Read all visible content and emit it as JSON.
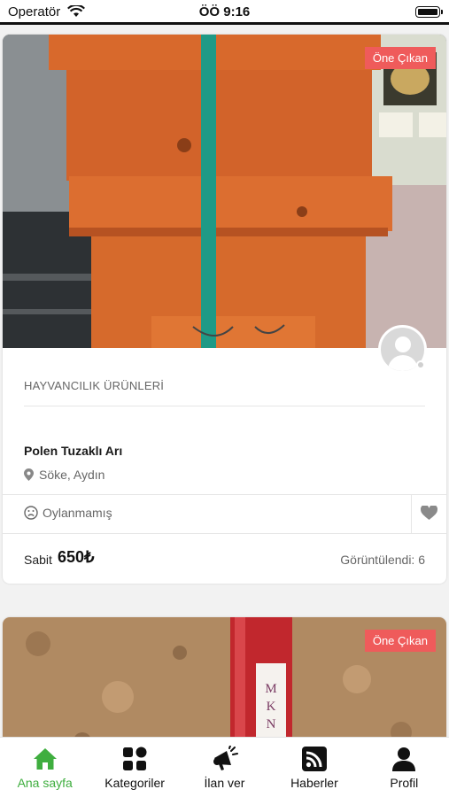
{
  "status_bar": {
    "carrier": "Operatör",
    "time": "ÖÖ 9:16"
  },
  "listings": [
    {
      "badge": "Öne Çıkan",
      "category": "HAYVANCILIK ÜRÜNLERİ",
      "title": "Polen Tuzaklı Arı",
      "location": "Söke, Aydın",
      "rating": "Oylanmamış",
      "price_type": "Sabit",
      "price": "650₺",
      "views": "Görüntülendi: 6"
    },
    {
      "badge": "Öne Çıkan"
    }
  ],
  "tabbar": {
    "active_color": "#3fae3f",
    "items": [
      {
        "label": "Ana sayfa",
        "icon": "home-icon"
      },
      {
        "label": "Kategoriler",
        "icon": "grid-icon"
      },
      {
        "label": "İlan ver",
        "icon": "megaphone-icon"
      },
      {
        "label": "Haberler",
        "icon": "rss-icon"
      },
      {
        "label": "Profil",
        "icon": "user-icon"
      }
    ]
  },
  "colors": {
    "badge": "#ef5b5b",
    "accent": "#3fae3f"
  }
}
